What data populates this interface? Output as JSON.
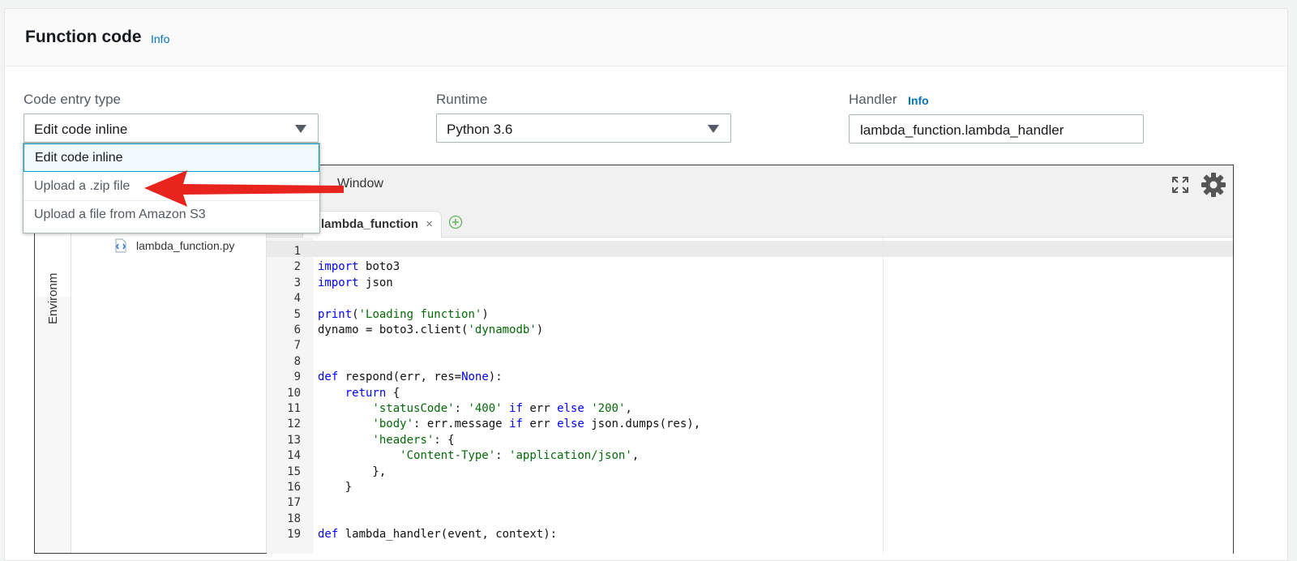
{
  "panel": {
    "title": "Function code",
    "info": "Info"
  },
  "fields": {
    "code_entry": {
      "label": "Code entry type",
      "value": "Edit code inline"
    },
    "runtime": {
      "label": "Runtime",
      "value": "Python 3.6"
    },
    "handler": {
      "label": "Handler",
      "info": "Info",
      "value": "lambda_function.lambda_handler"
    }
  },
  "dropdown": {
    "options": [
      "Edit code inline",
      "Upload a .zip file",
      "Upload a file from Amazon S3"
    ]
  },
  "ide": {
    "menu_window": "Window",
    "env_tab": "Environm",
    "file_name": "lambda_function.py",
    "tab_label": "lambda_function",
    "tab_close": "×"
  },
  "code": [
    {
      "n": "1",
      "t": ""
    },
    {
      "n": "2",
      "t": "import boto3"
    },
    {
      "n": "3",
      "t": "import json"
    },
    {
      "n": "4",
      "t": ""
    },
    {
      "n": "5",
      "t": "print('Loading function')"
    },
    {
      "n": "6",
      "t": "dynamo = boto3.client('dynamodb')"
    },
    {
      "n": "7",
      "t": ""
    },
    {
      "n": "8",
      "t": ""
    },
    {
      "n": "9",
      "t": "def respond(err, res=None):"
    },
    {
      "n": "10",
      "t": "    return {"
    },
    {
      "n": "11",
      "t": "        'statusCode': '400' if err else '200',"
    },
    {
      "n": "12",
      "t": "        'body': err.message if err else json.dumps(res),"
    },
    {
      "n": "13",
      "t": "        'headers': {"
    },
    {
      "n": "14",
      "t": "            'Content-Type': 'application/json',"
    },
    {
      "n": "15",
      "t": "        },"
    },
    {
      "n": "16",
      "t": "    }"
    },
    {
      "n": "17",
      "t": ""
    },
    {
      "n": "18",
      "t": ""
    },
    {
      "n": "19",
      "t": "def lambda_handler(event, context):"
    }
  ],
  "colors": {
    "accent": "#0073bb",
    "arrow": "#e8241f",
    "keyword": "#0000ff",
    "string": "#036a07"
  }
}
